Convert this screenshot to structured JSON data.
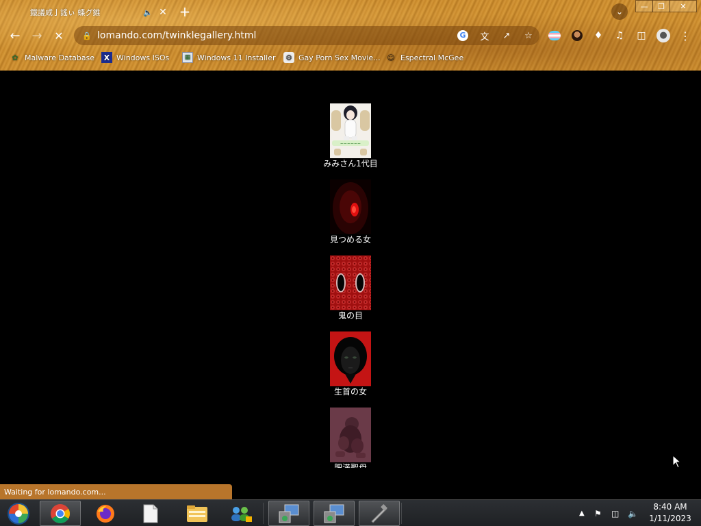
{
  "browser": {
    "tab": {
      "title": "鐡議咸亅謠ぃ 蝶グ錐",
      "audio_icon": "speaker-icon",
      "close_icon": "close-icon"
    },
    "new_tab_icon": "plus-icon",
    "address": {
      "url": "lomando.com/twinklegallery.html"
    },
    "bookmarks": [
      {
        "label": "Malware Database",
        "icon": "leaf-icon"
      },
      {
        "label": "Windows ISOs",
        "icon": "x-logo-icon"
      },
      {
        "label": "Windows 11 Installer",
        "icon": "installer-icon"
      },
      {
        "label": "Gay Porn Sex Movie...",
        "icon": "site-favicon-icon"
      },
      {
        "label": "Espectral McGee",
        "icon": "face-favicon-icon"
      }
    ],
    "status_text": "Waiting for lomando.com..."
  },
  "gallery": {
    "items": [
      {
        "caption": "みみさん1代目",
        "thumb": "mimi-thumbnail"
      },
      {
        "caption": "見つめる女",
        "thumb": "staring-woman-thumbnail"
      },
      {
        "caption": "鬼の目",
        "thumb": "demon-eyes-thumbnail"
      },
      {
        "caption": "生首の女",
        "thumb": "severed-head-woman-thumbnail"
      },
      {
        "caption": "肥満聖母",
        "thumb": "figure-thumbnail"
      }
    ]
  },
  "taskbar": {
    "clock_time": "8:40 AM",
    "clock_date": "1/11/2023"
  },
  "colors": {
    "page_background": "#000000",
    "status_bubble": "#b8752b",
    "chrome_wood": "#c88a2e"
  }
}
